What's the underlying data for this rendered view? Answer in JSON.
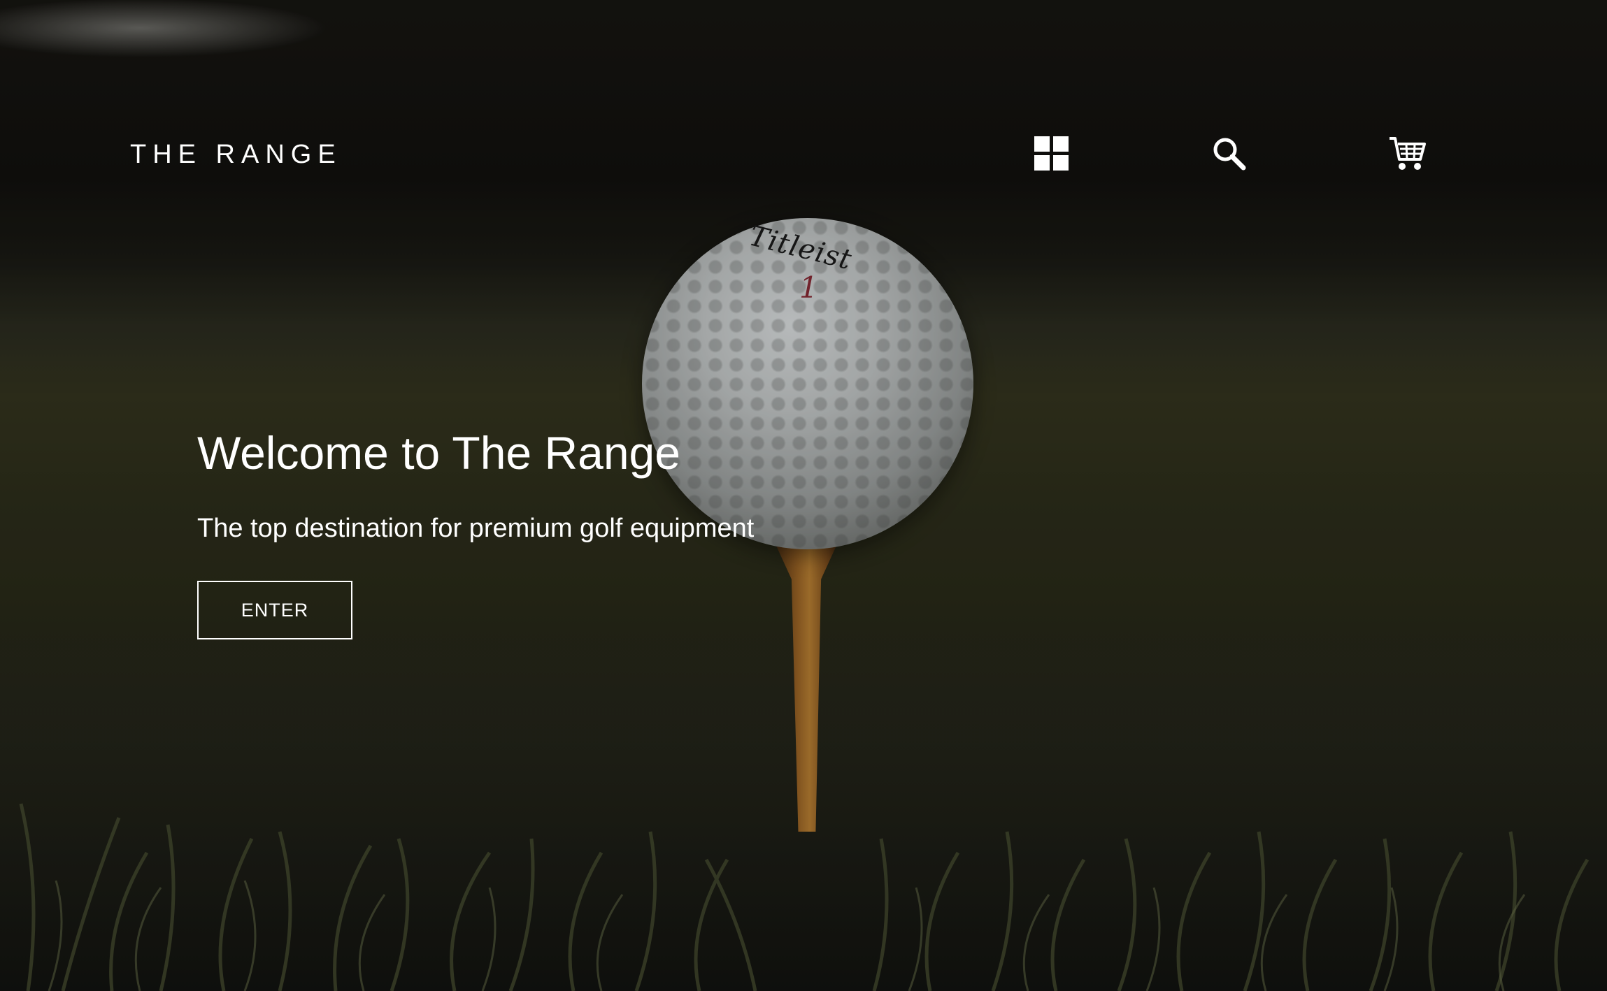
{
  "header": {
    "logo": "THE RANGE",
    "icons": [
      "grid-icon",
      "search-icon",
      "cart-icon"
    ]
  },
  "hero": {
    "title": "Welcome to The Range",
    "subtitle": "The top destination for premium golf equipment",
    "cta_label": "ENTER",
    "ball_brand": "Titleist",
    "ball_number": "1"
  },
  "colors": {
    "text": "#ffffff",
    "background": "#1a1a14"
  }
}
